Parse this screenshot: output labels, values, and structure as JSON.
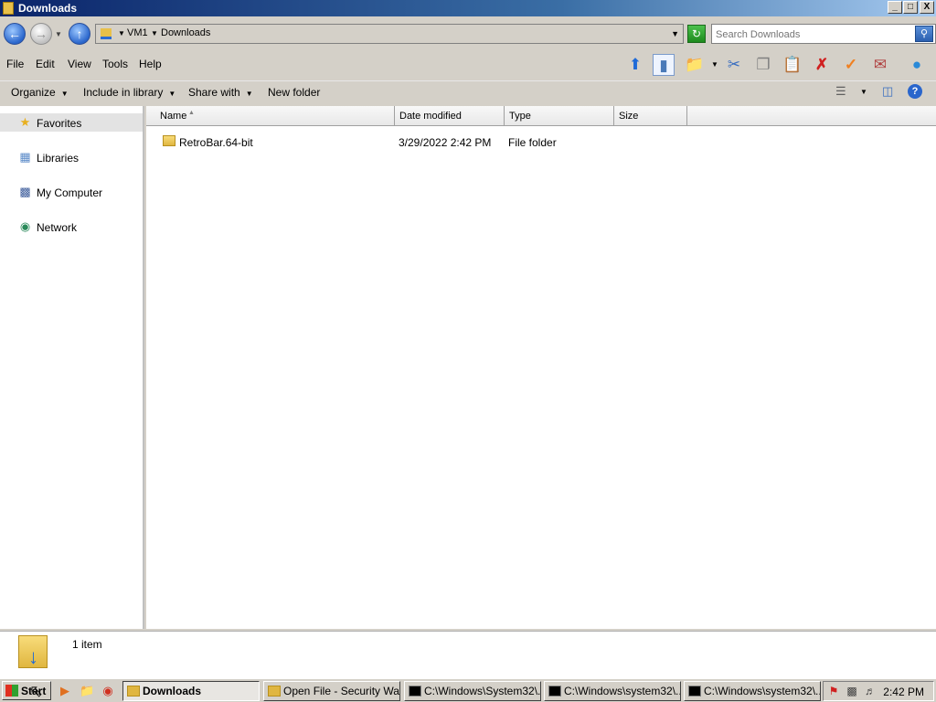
{
  "window": {
    "title": "Downloads",
    "controls": [
      "_",
      "□",
      "X"
    ]
  },
  "address": {
    "breadcrumbs": [
      "VM1",
      "Downloads"
    ],
    "search_placeholder": "Search Downloads"
  },
  "menu": {
    "items": [
      "File",
      "Edit",
      "View",
      "Tools",
      "Help"
    ]
  },
  "commands": {
    "organize": "Organize",
    "include_in_library": "Include in library",
    "share_with": "Share with",
    "new_folder": "New folder"
  },
  "nav": {
    "items": [
      {
        "label": "Favorites",
        "icon": "star-icon"
      },
      {
        "label": "Libraries",
        "icon": "libraries-icon"
      },
      {
        "label": "My Computer",
        "icon": "computer-icon"
      },
      {
        "label": "Network",
        "icon": "network-icon"
      }
    ]
  },
  "columns": [
    "Name",
    "Date modified",
    "Type",
    "Size"
  ],
  "files": [
    {
      "name": "RetroBar.64-bit",
      "date": "3/29/2022 2:42 PM",
      "type": "File folder",
      "size": ""
    }
  ],
  "details": {
    "count": "1 item"
  },
  "taskbar": {
    "start": "Start",
    "tasks": [
      {
        "label": "Downloads",
        "active": true
      },
      {
        "label": "Open File - Security Wa..."
      },
      {
        "label": "C:\\Windows\\System32\\..."
      },
      {
        "label": "C:\\Windows\\system32\\..."
      },
      {
        "label": "C:\\Windows\\system32\\..."
      }
    ],
    "clock": "2:42 PM"
  },
  "colors": {
    "titlebar_start": "#0a246a",
    "titlebar_end": "#a6caf0",
    "chrome": "#d4d0c8",
    "folder": "#e0b640",
    "accent_blue": "#2a66cc"
  }
}
